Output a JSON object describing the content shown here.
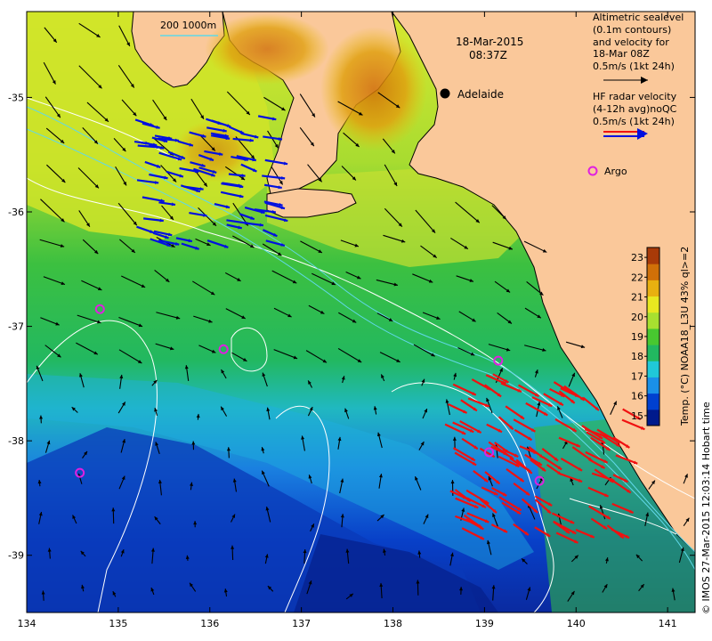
{
  "title": {
    "date": "18-Mar-2015",
    "time": "08:37Z"
  },
  "scale_bar": {
    "label": "200  1000m"
  },
  "city": {
    "name": "Adelaide",
    "lon": 138.6,
    "lat": -34.93
  },
  "legend": {
    "altimetric_lines": [
      "Altimetric sealevel",
      "(0.1m contours)",
      "and velocity for",
      "18-Mar 08Z",
      "0.5m/s (1kt 24h)"
    ],
    "hf_radar_lines": [
      "HF radar velocity",
      "(4-12h avg)noQC",
      "0.5m/s (1kt 24h)"
    ],
    "argo_label": "Argo"
  },
  "colorbar": {
    "label": "Temp. (°C) NOAA18_L3U 43% ql>=2",
    "ticks": [
      "15",
      "16",
      "17",
      "18",
      "19",
      "20",
      "21",
      "22",
      "23"
    ],
    "min": 14.5,
    "max": 23.5,
    "colors": [
      "#001a8c",
      "#0040d0",
      "#1a90e8",
      "#20c8d8",
      "#22b860",
      "#48c830",
      "#a8e030",
      "#e8e820",
      "#e8b010",
      "#d07008",
      "#a83a08"
    ]
  },
  "credit": "© IMOS 27-Mar-2015 12:03:14 Hobart time",
  "chart_data": {
    "type": "map",
    "xlim": [
      134,
      141.3
    ],
    "ylim": [
      -39.5,
      -34.25
    ],
    "x_ticks": [
      "134",
      "135",
      "136",
      "137",
      "138",
      "139",
      "140",
      "141"
    ],
    "y_ticks": [
      "-35",
      "-36",
      "-37",
      "-38",
      "-39"
    ],
    "argo_floats": [
      {
        "lon": 134.8,
        "lat": -36.85
      },
      {
        "lon": 136.15,
        "lat": -37.2
      },
      {
        "lon": 139.15,
        "lat": -37.3
      },
      {
        "lon": 139.05,
        "lat": -38.1
      },
      {
        "lon": 139.6,
        "lat": -38.35
      },
      {
        "lon": 134.58,
        "lat": -38.28
      }
    ]
  }
}
